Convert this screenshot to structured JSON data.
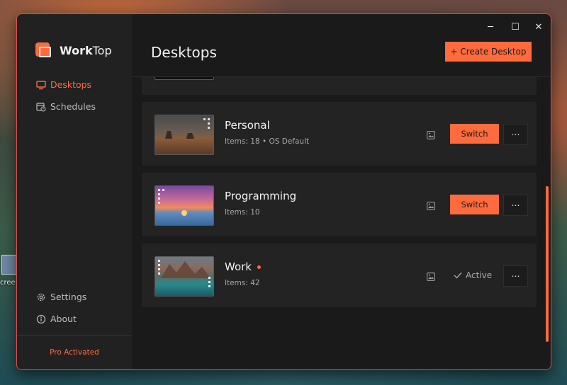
{
  "desktop": {
    "icon_label": "creen"
  },
  "window": {
    "controls": {
      "minimize": "─",
      "maximize": "☐",
      "close": "✕"
    }
  },
  "sidebar": {
    "brand_bold": "Work",
    "brand_light": "Top",
    "nav": [
      {
        "label": "Desktops",
        "icon": "monitor-icon",
        "active": true
      },
      {
        "label": "Schedules",
        "icon": "calendar-clock-icon",
        "active": false
      }
    ],
    "bottom_nav": [
      {
        "label": "Settings",
        "icon": "gear-icon"
      },
      {
        "label": "About",
        "icon": "info-icon"
      }
    ],
    "status": "Pro Activated"
  },
  "header": {
    "title": "Desktops",
    "create_label": "+ Create Desktop"
  },
  "desktops": [
    {
      "name": "Personal",
      "meta": "Items: 18 • OS Default",
      "action": "Switch",
      "active": false
    },
    {
      "name": "Programming",
      "meta": "Items: 10",
      "action": "Switch",
      "active": false
    },
    {
      "name": "Work",
      "meta": "Items: 42",
      "action": "Active",
      "active": true
    }
  ],
  "colors": {
    "accent": "#ff6b3d",
    "bg": "#1a1a1a",
    "sidebar": "#212121",
    "card": "#232323"
  }
}
